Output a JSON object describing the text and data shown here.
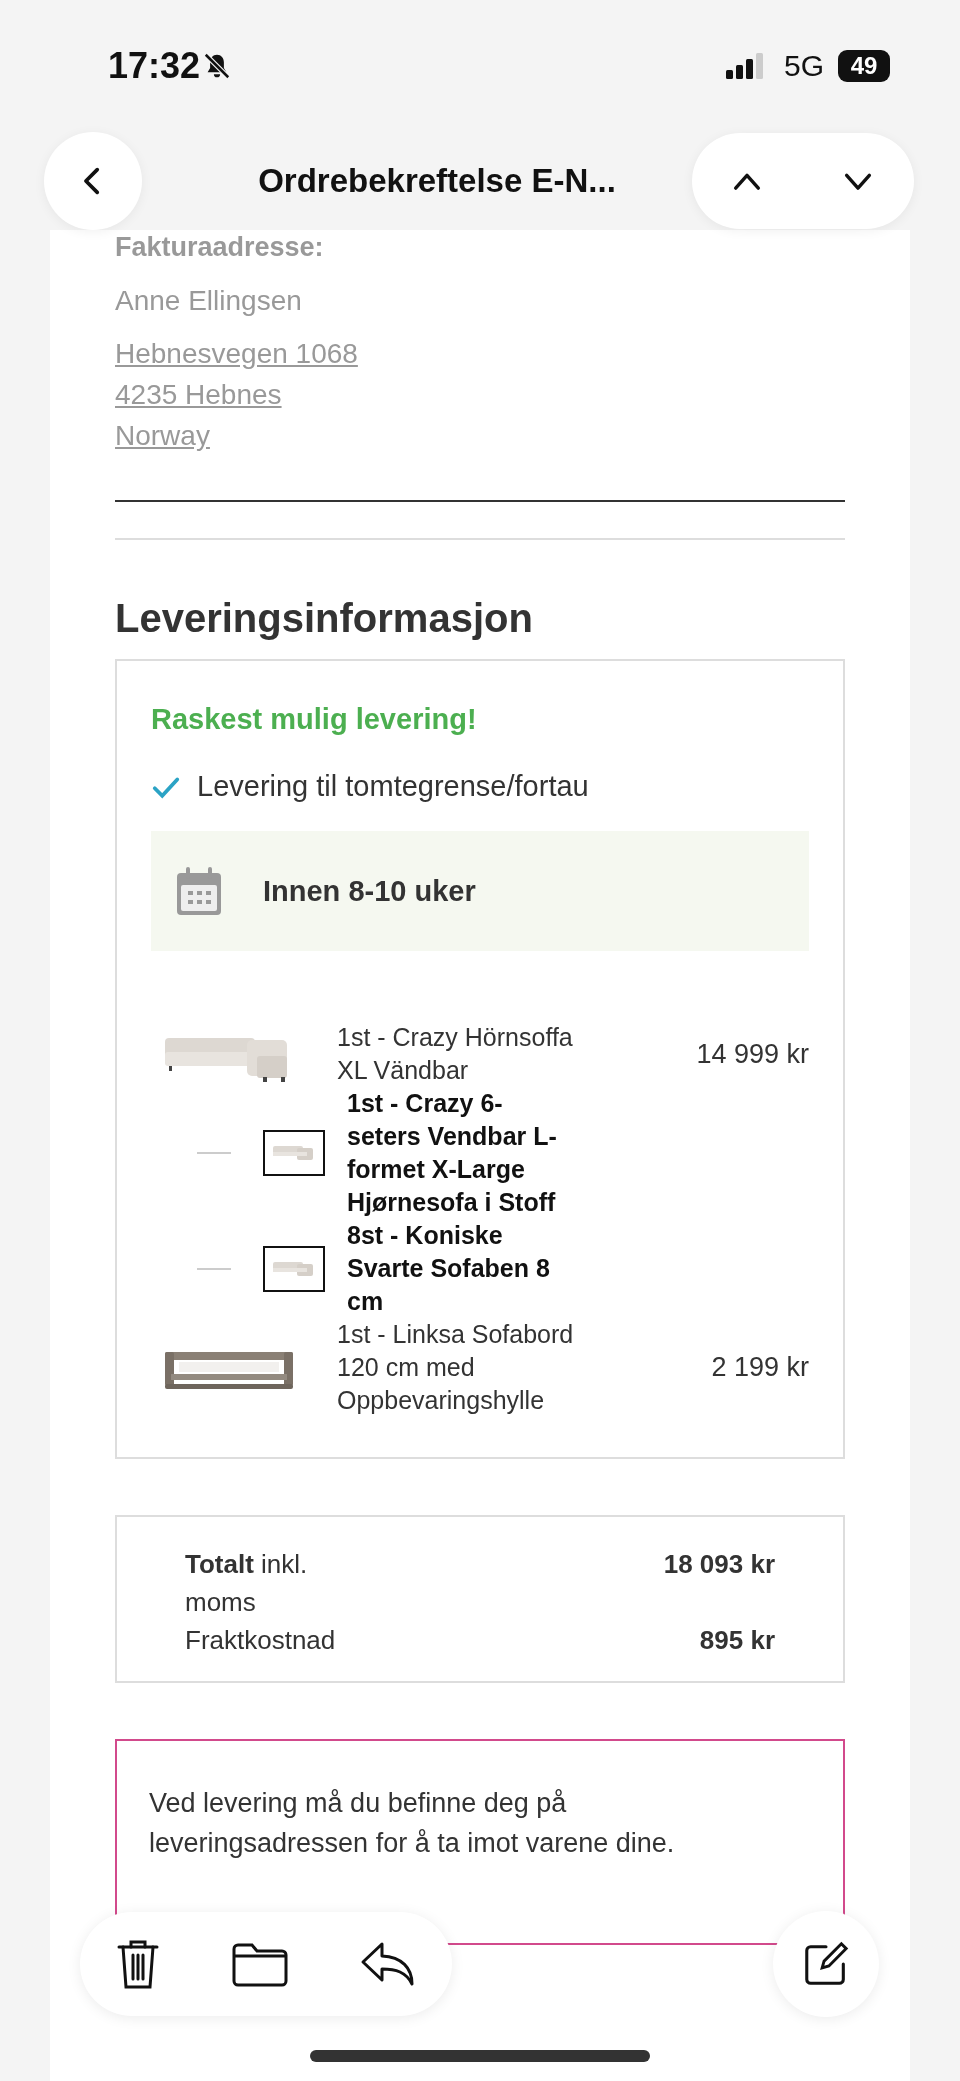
{
  "status_bar": {
    "time": "17:32",
    "network": "5G",
    "battery": "49"
  },
  "nav": {
    "title": "Ordrebekreftelse E-N..."
  },
  "billing": {
    "heading": "Fakturaadresse:",
    "name": "Anne Ellingsen",
    "address_lines": [
      "Hebnesvegen 1068",
      "4235 Hebnes",
      "Norway"
    ]
  },
  "delivery": {
    "heading": "Leveringsinformasjon",
    "highlight": "Raskest mulig levering!",
    "method": "Levering til tomtegrense/fortau",
    "eta": "Innen 8-10 uker",
    "items": [
      {
        "kind": "product",
        "text": "1st - Crazy Hörnsoffa XL Vändbar",
        "price": "14 999 kr"
      },
      {
        "kind": "component",
        "text": "1st - Crazy 6-seters Vendbar L-formet X-Large Hjørnesofa i Stoff"
      },
      {
        "kind": "component",
        "text": "8st - Koniske Svarte Sofaben 8 cm"
      },
      {
        "kind": "product",
        "text": "1st - Linksa Sofabord 120 cm med Oppbevaringshylle",
        "price": "2 199 kr"
      }
    ]
  },
  "totals": [
    {
      "label": "**Totalt** inkl. moms",
      "value": "18 093 kr"
    },
    {
      "label": "Fraktkostnad",
      "value": "895 kr"
    }
  ],
  "notice": "Ved levering må du befinne deg på leveringsadressen for å ta imot varene dine."
}
